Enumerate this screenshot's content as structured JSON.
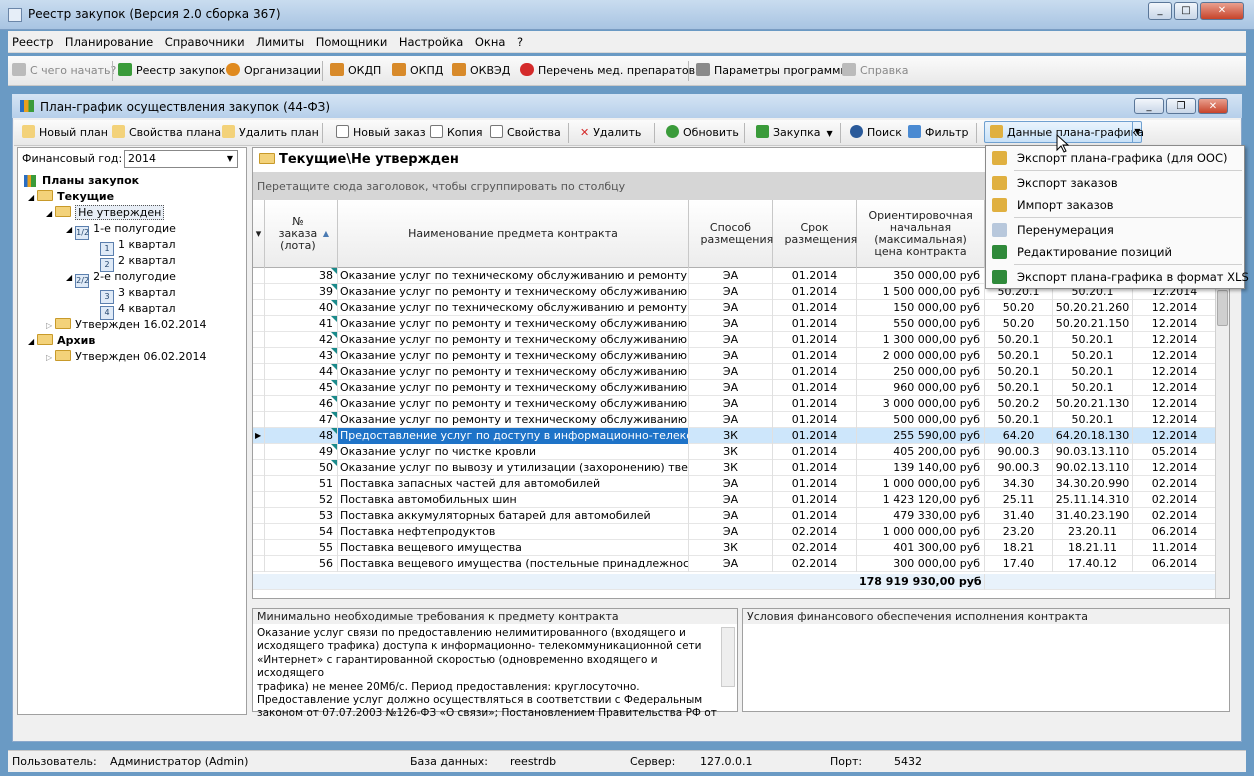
{
  "window": {
    "title": "Реестр закупок (Версия 2.0 сборка 367)"
  },
  "menu": [
    "Реестр",
    "Планирование",
    "Справочники",
    "Лимиты",
    "Помощники",
    "Настройка",
    "Окна",
    "?"
  ],
  "toolbar": {
    "start": "С чего начать?",
    "registry": "Реестр закупок",
    "orgs": "Организации",
    "okdp": "ОКДП",
    "okpd": "ОКПД",
    "okved": "ОКВЭД",
    "med": "Перечень мед. препаратов",
    "params": "Параметры программы",
    "help": "Справка"
  },
  "inner": {
    "title": "План-график осуществления закупок (44-ФЗ)",
    "toolbar": {
      "new_plan": "Новый план",
      "plan_props": "Свойства плана",
      "del_plan": "Удалить план",
      "new_order": "Новый заказ",
      "copy": "Копия",
      "props": "Свойства",
      "delete": "Удалить",
      "refresh": "Обновить",
      "purchase": "Закупка",
      "search": "Поиск",
      "filter": "Фильтр",
      "plan_data": "Данные плана-графика"
    }
  },
  "left": {
    "year_label": "Финансовый год:",
    "year_value": "2014",
    "tree": {
      "root": "Планы закупок",
      "current": "Текущие",
      "not_approved": "Не утвержден",
      "h1": "1-е полугодие",
      "q1": "1 квартал",
      "q2": "2 квартал",
      "h2": "2-е полугодие",
      "q3": "3 квартал",
      "q4": "4 квартал",
      "approved1": "Утвержден 16.02.2014",
      "archive": "Архив",
      "approved2": "Утвержден 06.02.2014"
    }
  },
  "grid": {
    "title": "Текущие\\Не утвержден",
    "group_hint": "Перетащите сюда заголовок, чтобы сгруппировать по столбцу",
    "headers": {
      "num": "№ заказа (лота)",
      "name": "Наименование предмета контракта",
      "method": "Способ размещения",
      "term": "Срок размещения",
      "price": "Ориентировочная начальная (максимальная) цена контракта"
    },
    "rows": [
      [
        "38",
        "Оказание услуг по техническому обслуживанию и ремонту нахо…",
        "ЭА",
        "01.2014",
        "350 000,00 руб",
        "",
        "",
        ""
      ],
      [
        "39",
        "Оказание услуг по ремонту и техническому обслуживанию легко…",
        "ЭА",
        "01.2014",
        "1 500 000,00 руб",
        "50.20.1",
        "50.20.1",
        "12.2014"
      ],
      [
        "40",
        "Оказание услуг по техническому обслуживанию и ремонту нахо…",
        "ЭА",
        "01.2014",
        "150 000,00 руб",
        "50.20",
        "50.20.21.260",
        "12.2014"
      ],
      [
        "41",
        "Оказание услуг по ремонту и техническому обслуживанию легко…",
        "ЭА",
        "01.2014",
        "550 000,00 руб",
        "50.20",
        "50.20.21.150",
        "12.2014"
      ],
      [
        "42",
        "Оказание услуг по ремонту и техническому обслуживанию легко…",
        "ЭА",
        "01.2014",
        "1 300 000,00 руб",
        "50.20.1",
        "50.20.1",
        "12.2014"
      ],
      [
        "43",
        "Оказание услуг по ремонту и техническому обслуживанию легко…",
        "ЭА",
        "01.2014",
        "2 000 000,00 руб",
        "50.20.1",
        "50.20.1",
        "12.2014"
      ],
      [
        "44",
        "Оказание услуг по ремонту и техническому обслуживанию легко…",
        "ЭА",
        "01.2014",
        "250 000,00 руб",
        "50.20.1",
        "50.20.1",
        "12.2014"
      ],
      [
        "45",
        "Оказание услуг по ремонту и техническому обслуживанию легко…",
        "ЭА",
        "01.2014",
        "960 000,00 руб",
        "50.20.1",
        "50.20.1",
        "12.2014"
      ],
      [
        "46",
        "Оказание услуг по ремонту и техническому обслуживанию грузо…",
        "ЭА",
        "01.2014",
        "3 000 000,00 руб",
        "50.20.2",
        "50.20.21.130",
        "12.2014"
      ],
      [
        "47",
        "Оказание услуг по ремонту и техническому обслуживанию легко…",
        "ЭА",
        "01.2014",
        "500 000,00 руб",
        "50.20.1",
        "50.20.1",
        "12.2014"
      ],
      [
        "48",
        "Предоставление услуг по доступу в информационно-телекоммун…",
        "ЗК",
        "01.2014",
        "255 590,00 руб",
        "64.20",
        "64.20.18.130",
        "12.2014"
      ],
      [
        "49",
        "Оказание услуг по чистке кровли",
        "ЗК",
        "01.2014",
        "405 200,00 руб",
        "90.00.3",
        "90.03.13.110",
        "05.2014"
      ],
      [
        "50",
        "Оказание услуг по вывозу и утилизации (захоронению) твердых…",
        "ЗК",
        "01.2014",
        "139 140,00 руб",
        "90.00.3",
        "90.02.13.110",
        "12.2014"
      ],
      [
        "51",
        "Поставка запасных частей для автомобилей",
        "ЭА",
        "01.2014",
        "1 000 000,00 руб",
        "34.30",
        "34.30.20.990",
        "02.2014"
      ],
      [
        "52",
        "Поставка автомобильных шин",
        "ЭА",
        "01.2014",
        "1 423 120,00 руб",
        "25.11",
        "25.11.14.310",
        "02.2014"
      ],
      [
        "53",
        "Поставка аккумуляторных батарей для автомобилей",
        "ЭА",
        "01.2014",
        "479 330,00 руб",
        "31.40",
        "31.40.23.190",
        "02.2014"
      ],
      [
        "54",
        "Поставка нефтепродуктов",
        "ЭА",
        "02.2014",
        "1 000 000,00 руб",
        "23.20",
        "23.20.11",
        "06.2014"
      ],
      [
        "55",
        "Поставка вещевого имущества",
        "ЗК",
        "02.2014",
        "401 300,00 руб",
        "18.21",
        "18.21.11",
        "11.2014"
      ],
      [
        "56",
        "Поставка вещевого имущества (постельные принадлежности)",
        "ЭА",
        "02.2014",
        "300 000,00 руб",
        "17.40",
        "17.40.12",
        "06.2014"
      ]
    ],
    "total": "178 919 930,00 руб"
  },
  "bottom": {
    "left_title": "Минимально необходимые требования  к предмету контракта",
    "left_text1": "Оказание услуг связи по предоставлению нелимитированного (входящего и",
    "left_text2": "исходящего трафика)  доступа к информационно- телекоммуникационной сети",
    "left_text3": "«Интернет» с гарантированной скоростью (одновременно входящего и исходящего",
    "left_text4": "трафика) не менее 20Мб/с. Период предоставления: круглосуточно.",
    "left_text5": "   Предоставление услуг должно осуществляться в соответствии с Федеральным",
    "left_text6": "законом от 07.07.2003 №126-ФЗ «О связи»; Постановлением Правительства РФ от",
    "right_title": "Условия финансового обеспечения исполнения контракта"
  },
  "dropdown": [
    "Экспорт плана-графика (для ООС)",
    "Экспорт заказов",
    "Импорт заказов",
    "Перенумерация",
    "Редактирование позиций",
    "Экспорт плана-графика в формат XLS"
  ],
  "status": {
    "user_label": "Пользователь:",
    "user": "Администратор (Admin)",
    "db_label": "База данных:",
    "db": "reestrdb",
    "server_label": "Сервер:",
    "server": "127.0.0.1",
    "port_label": "Порт:",
    "port": "5432"
  }
}
